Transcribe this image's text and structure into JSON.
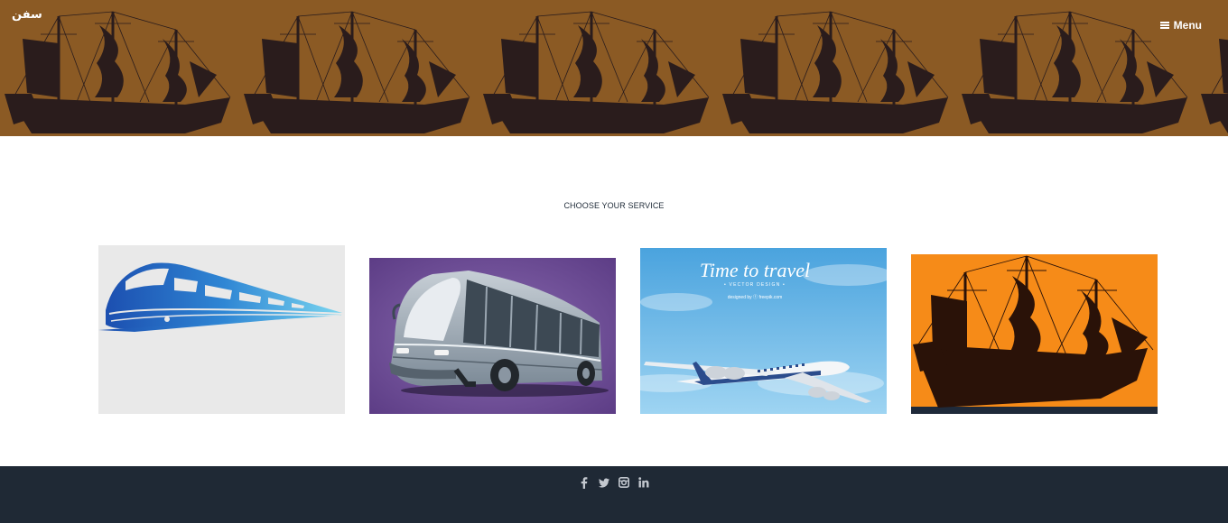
{
  "header": {
    "logo_text": "سفن",
    "menu_label": "Menu",
    "menu_icon": "hamburger-icon",
    "banner_colors": {
      "background": "#8b5a24",
      "silhouette": "#2a1c1c"
    }
  },
  "services": {
    "title": "CHOOSE YOUR SERVICE",
    "cards": [
      {
        "name": "train",
        "image": "blue-train-logo"
      },
      {
        "name": "bus",
        "image": "grey-bus-on-purple"
      },
      {
        "name": "plane",
        "image": "airplane-in-blue-sky",
        "headline": "Time to travel",
        "subline": "• VECTOR DESIGN •",
        "credit": "designed by ⓕ freepik.com"
      },
      {
        "name": "ship",
        "image": "ship-silhouette-on-orange"
      }
    ]
  },
  "footer": {
    "background": "#1f2935",
    "social": [
      {
        "name": "facebook",
        "glyph": "f"
      },
      {
        "name": "twitter",
        "glyph": "twitter-icon"
      },
      {
        "name": "instagram",
        "glyph": "instagram-icon"
      },
      {
        "name": "linkedin",
        "glyph": "in"
      }
    ]
  }
}
